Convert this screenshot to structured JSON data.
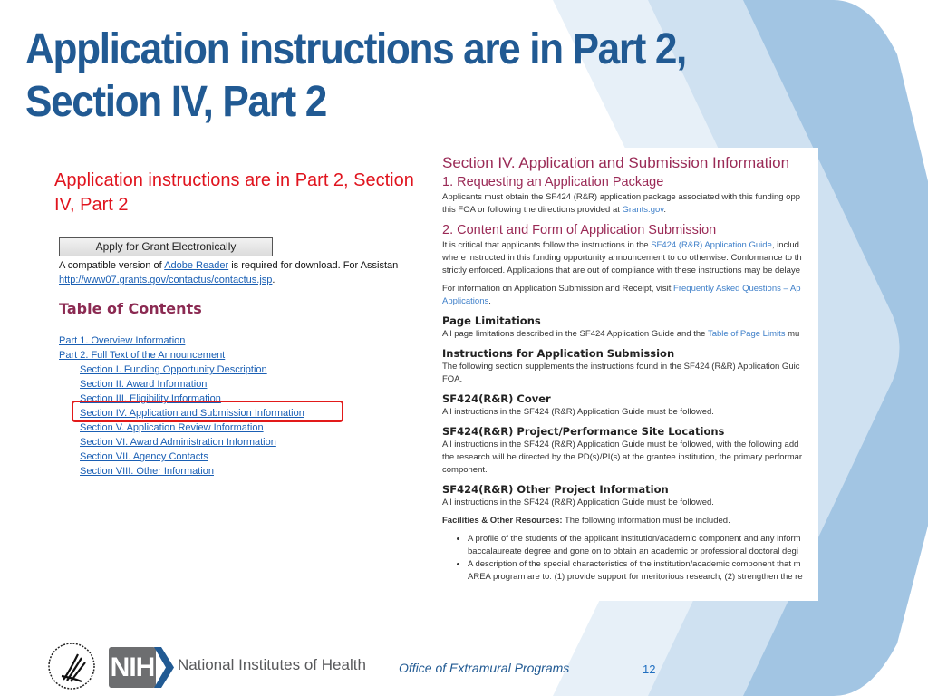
{
  "slide": {
    "title": "Application instructions are in Part 2, Section IV, Part 2",
    "subtitle": "Application instructions are in Part 2, Section IV, Part 2",
    "page_number": "12",
    "colors": {
      "title": "#215a93",
      "subtitle": "#e0141e",
      "highlight": "#e21a1a",
      "chevron_light": "#e7f0f8",
      "chevron_mid": "#cfe1f1",
      "chevron_dark": "#a2c5e3"
    }
  },
  "left_screenshot": {
    "apply_button": "Apply for Grant Electronically",
    "compat_prefix": "A compatible version of ",
    "compat_link": "Adobe Reader",
    "compat_suffix": " is required for download. For Assistan",
    "contact_link": "http://www07.grants.gov/contactus/contactus.jsp",
    "contact_suffix": ".",
    "toc_title": "Table of Contents",
    "toc": [
      "Part 1. Overview Information",
      "Part 2. Full Text of the Announcement",
      "Section I. Funding Opportunity Description",
      "Section II. Award Information",
      "Section III. Eligibility Information",
      "Section IV. Application and Submission Information",
      "Section V. Application Review Information",
      "Section VI. Award Administration Information",
      "Section VII. Agency Contacts",
      "Section VIII. Other Information"
    ],
    "highlighted_item": "Section IV. Application and Submission Information"
  },
  "right_screenshot": {
    "heading": "Section IV. Application and Submission Information",
    "s1_title": "1. Requesting an Application Package",
    "s1_line1": "Applicants must obtain the SF424 (R&R) application package associated with this funding opp",
    "s1_line2_prefix": "this FOA or following the directions provided at ",
    "s1_link": "Grants.gov",
    "s1_line2_suffix": ".",
    "s2_title": "2. Content and Form of Application Submission",
    "s2_line1_prefix": "It is critical that applicants follow the instructions in the ",
    "s2_link": "SF424 (R&R) Application Guide",
    "s2_line1_suffix": ", includ",
    "s2_line2": "where instructed in this funding opportunity announcement to do otherwise. Conformance to th",
    "s2_line3": "strictly enforced. Applications that are out of compliance with these instructions may be delaye",
    "s2_info_prefix": "For information on Application Submission and Receipt, visit ",
    "s2_info_link": "Frequently Asked Questions – Ap",
    "s2_info_link2": "Applications",
    "s2_info_suffix": ".",
    "page_limits_title": "Page Limitations",
    "page_limits_prefix": "All page limitations described in the SF424 Application Guide and the ",
    "page_limits_link": "Table of Page Limits",
    "page_limits_suffix": " mu",
    "instr_title": "Instructions for Application Submission",
    "instr_line1": "The following section supplements the instructions found in the SF424 (R&R) Application Guic",
    "instr_line2": "FOA.",
    "cover_title": "SF424(R&R) Cover",
    "cover_text": "All instructions in the SF424 (R&R) Application Guide must be followed.",
    "sites_title": "SF424(R&R) Project/Performance Site Locations",
    "sites_line1": "All instructions in the SF424 (R&R) Application Guide must be followed, with the following add",
    "sites_line2": "the research will be directed by the PD(s)/PI(s) at the grantee institution, the primary performar",
    "sites_line3": "component.",
    "other_title": "SF424(R&R) Other Project Information",
    "other_text": "All instructions in the SF424 (R&R) Application Guide must be followed.",
    "facilities_label": "Facilities & Other Resources:",
    "facilities_text": " The following information must be included.",
    "bullets": [
      {
        "line1": "A profile of the students of the applicant institution/academic component and any inform",
        "line2": "baccalaureate degree and gone on to obtain an academic or professional doctoral degi"
      },
      {
        "line1": "A description of the special characteristics of the institution/academic component that m",
        "line2": "AREA program are to: (1) provide support for meritorious research; (2) strengthen the re"
      }
    ]
  },
  "footer": {
    "hhs_seal": "hhs-seal-icon",
    "nih_logo_text": "NIH",
    "nih_name": "National Institutes of Health",
    "office": "Office of Extramural Programs"
  }
}
